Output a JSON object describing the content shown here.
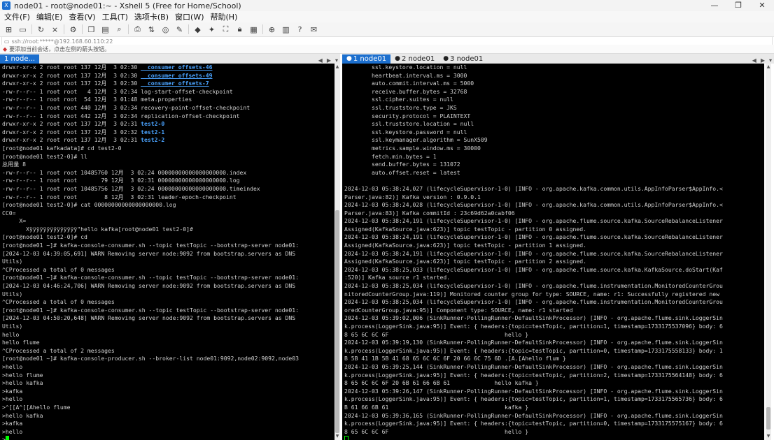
{
  "window": {
    "title": "node01 - root@node01:~ - Xshell 5 (Free for Home/School)",
    "controls": {
      "minimize": "—",
      "maximize": "❐",
      "close": "✕"
    }
  },
  "menu": [
    "文件(F)",
    "编辑(E)",
    "查看(V)",
    "工具(T)",
    "选项卡(B)",
    "窗口(W)",
    "帮助(H)"
  ],
  "toolbar": {
    "icons": [
      "new-session-icon",
      "open-folder-icon",
      "reconnect-icon",
      "disconnect-icon",
      "properties-icon",
      "copy-icon",
      "paste-icon",
      "find-icon",
      "print-icon",
      "transfer-icon",
      "globe-icon",
      "highlight-icon",
      "xftp-icon",
      "compose-icon",
      "fullscreen-icon",
      "lock-icon",
      "keyboard-icon",
      "add-icon",
      "layout-icon",
      "help-icon",
      "chat-icon"
    ]
  },
  "address": {
    "text": "ssh://root:*****@192.168.60.110:22"
  },
  "hint": {
    "text": "要添加当前会话，点击左侧的箭头按钮。"
  },
  "left_tabs": [
    {
      "label": "1 node...",
      "active": true
    }
  ],
  "right_tabs": [
    {
      "label": "1 node01",
      "active": true
    },
    {
      "label": "2 node01",
      "active": false
    },
    {
      "label": "3 node01",
      "active": false
    }
  ],
  "left_terminal": {
    "lines": [
      {
        "t": "drwxr-xr-x 2 root root 137 12月  3 02:30 ",
        "h": "__consumer_offsets-46",
        "style": "blue-u"
      },
      {
        "t": "drwxr-xr-x 2 root root 137 12月  3 02:30 ",
        "h": "__consumer_offsets-49",
        "style": "blue-u"
      },
      {
        "t": "drwxr-xr-x 2 root root 137 12月  3 02:30 ",
        "h": "__consumer_offsets-7",
        "style": "blue-u"
      },
      {
        "t": "-rw-r--r-- 1 root root   4 12月  3 02:34 log-start-offset-checkpoint"
      },
      {
        "t": "-rw-r--r-- 1 root root  54 12月  3 01:48 meta.properties"
      },
      {
        "t": "-rw-r--r-- 1 root root 440 12月  3 02:34 recovery-point-offset-checkpoint"
      },
      {
        "t": "-rw-r--r-- 1 root root 442 12月  3 02:34 replication-offset-checkpoint"
      },
      {
        "t": "drwxr-xr-x 2 root root 137 12月  3 02:31 ",
        "h": "test2-0",
        "style": "blue"
      },
      {
        "t": "drwxr-xr-x 2 root root 137 12月  3 02:32 ",
        "h": "test2-1",
        "style": "blue"
      },
      {
        "t": "drwxr-xr-x 2 root root 137 12月  3 02:31 ",
        "h": "test2-2",
        "style": "blue"
      },
      {
        "t": "[root@node01 kafkadata]# cd test2-0"
      },
      {
        "t": "[root@node01 test2-0]# ll"
      },
      {
        "t": "总用量 8"
      },
      {
        "t": "-rw-r--r-- 1 root root 10485760 12月  3 02:24 00000000000000000000.index"
      },
      {
        "t": "-rw-r--r-- 1 root root       79 12月  3 02:31 00000000000000000000.log"
      },
      {
        "t": "-rw-r--r-- 1 root root 10485756 12月  3 02:24 00000000000000000000.timeindex"
      },
      {
        "t": "-rw-r--r-- 1 root root        8 12月  3 02:31 leader-epoch-checkpoint"
      },
      {
        "t": "[root@node01 test2-0]# cat 00000000000000000000.log"
      },
      {
        "t": "CC0="
      },
      {
        "t": "     X="
      },
      {
        "t": "       Xÿÿÿÿÿÿÿÿÿÿÿÿÿÿ\"hello kafka[root@node01 test2-0]#"
      },
      {
        "t": "[root@node01 test2-0]# cd"
      },
      {
        "t": "[root@node01 ~]# kafka-console-consumer.sh --topic testTopic --bootstrap-server node01:"
      },
      {
        "t": "[2024-12-03 04:39:05,691] WARN Removing server node:9092 from bootstrap.servers as DNS"
      },
      {
        "t": "Utils)"
      },
      {
        "t": "^CProcessed a total of 0 messages"
      },
      {
        "t": "[root@node01 ~]# kafka-console-consumer.sh --topic testTopic --bootstrap-server node01:"
      },
      {
        "t": "[2024-12-03 04:46:24,706] WARN Removing server node:9092 from bootstrap.servers as DNS"
      },
      {
        "t": "Utils)"
      },
      {
        "t": "^CProcessed a total of 0 messages"
      },
      {
        "t": "[root@node01 ~]# kafka-console-consumer.sh --topic testTopic --bootstrap-server node01:"
      },
      {
        "t": "[2024-12-03 04:50:20,648] WARN Removing server node:9092 from bootstrap.servers as DNS"
      },
      {
        "t": "Utils)"
      },
      {
        "t": "hello"
      },
      {
        "t": "hello flume"
      },
      {
        "t": "^CProcessed a total of 2 messages"
      },
      {
        "t": "[root@node01 ~]# kafka-console-producer.sh --broker-list node01:9092,node02:9092,node03"
      },
      {
        "t": ">hello"
      },
      {
        "t": ">hello flume"
      },
      {
        "t": ">hello kafka"
      },
      {
        "t": ">kafka"
      },
      {
        "t": ">hello"
      },
      {
        "t": ">^[[A^[[Ahello flume"
      },
      {
        "t": ">hello kafka"
      },
      {
        "t": ">kafka"
      },
      {
        "t": ">hello"
      },
      {
        "t": ">",
        "cursor": "solid"
      }
    ]
  },
  "right_terminal": {
    "lines": [
      {
        "t": "        ssl.keystore.location = null"
      },
      {
        "t": "        heartbeat.interval.ms = 3000"
      },
      {
        "t": "        auto.commit.interval.ms = 5000"
      },
      {
        "t": "        receive.buffer.bytes = 32768"
      },
      {
        "t": "        ssl.cipher.suites = null"
      },
      {
        "t": "        ssl.truststore.type = JKS"
      },
      {
        "t": "        security.protocol = PLAINTEXT"
      },
      {
        "t": "        ssl.truststore.location = null"
      },
      {
        "t": "        ssl.keystore.password = null"
      },
      {
        "t": "        ssl.keymanager.algorithm = SunX509"
      },
      {
        "t": "        metrics.sample.window.ms = 30000"
      },
      {
        "t": "        fetch.min.bytes = 1"
      },
      {
        "t": "        send.buffer.bytes = 131072"
      },
      {
        "t": "        auto.offset.reset = latest"
      },
      {
        "t": ""
      },
      {
        "t": "2024-12-03 05:38:24,027 (lifecycleSupervisor-1-0) [INFO - org.apache.kafka.common.utils.AppInfoParser$AppInfo.<"
      },
      {
        "t": "Parser.java:82)] Kafka version : 0.9.0.1"
      },
      {
        "t": "2024-12-03 05:38:24,028 (lifecycleSupervisor-1-0) [INFO - org.apache.kafka.common.utils.AppInfoParser$AppInfo.<"
      },
      {
        "t": "Parser.java:83)] Kafka commitId : 23c69d62a0cabf06"
      },
      {
        "t": "2024-12-03 05:38:24,191 (lifecycleSupervisor-1-0) [INFO - org.apache.flume.source.kafka.SourceRebalanceListener"
      },
      {
        "t": "Assigned(KafkaSource.java:623)] topic testTopic - partition 0 assigned."
      },
      {
        "t": "2024-12-03 05:38:24,191 (lifecycleSupervisor-1-0) [INFO - org.apache.flume.source.kafka.SourceRebalanceListener"
      },
      {
        "t": "Assigned(KafkaSource.java:623)] topic testTopic - partition 1 assigned."
      },
      {
        "t": "2024-12-03 05:38:24,191 (lifecycleSupervisor-1-0) [INFO - org.apache.flume.source.kafka.SourceRebalanceListener"
      },
      {
        "t": "Assigned(KafkaSource.java:623)] topic testTopic - partition 2 assigned."
      },
      {
        "t": "2024-12-03 05:38:25,033 (lifecycleSupervisor-1-0) [INFO - org.apache.flume.source.kafka.KafkaSource.doStart(Kaf"
      },
      {
        "t": ":520)] Kafka source r1 started."
      },
      {
        "t": "2024-12-03 05:38:25,034 (lifecycleSupervisor-1-0) [INFO - org.apache.flume.instrumentation.MonitoredCounterGrou"
      },
      {
        "t": "nitoredCounterGroup.java:119)] Monitored counter group for type: SOURCE, name: r1: Successfully registered new"
      },
      {
        "t": "2024-12-03 05:38:25,034 (lifecycleSupervisor-1-0) [INFO - org.apache.flume.instrumentation.MonitoredCounterGrou"
      },
      {
        "t": "oredCounterGroup.java:95)] Component type: SOURCE, name: r1 started"
      },
      {
        "t": "2024-12-03 05:39:02,006 (SinkRunner-PollingRunner-DefaultSinkProcessor) [INFO - org.apache.flume.sink.LoggerSin"
      },
      {
        "t": "k.process(LoggerSink.java:95)] Event: { headers:{topic=testTopic, partition=1, timestamp=1733175537096} body: 6"
      },
      {
        "t": "8 65 6C 6C 6F                                  hello }"
      },
      {
        "t": "2024-12-03 05:39:19,130 (SinkRunner-PollingRunner-DefaultSinkProcessor) [INFO - org.apache.flume.sink.LoggerSin"
      },
      {
        "t": "k.process(LoggerSink.java:95)] Event: { headers:{topic=testTopic, partition=0, timestamp=1733175558133} body: 1"
      },
      {
        "t": "B 5B 41 1B 5B 41 68 65 6C 6C 6F 20 66 6C 75 6D .[A.[Ahello flum }"
      },
      {
        "t": "2024-12-03 05:39:25,144 (SinkRunner-PollingRunner-DefaultSinkProcessor) [INFO - org.apache.flume.sink.LoggerSin"
      },
      {
        "t": "k.process(LoggerSink.java:95)] Event: { headers:{topic=testTopic, partition=2, timestamp=1733175564148} body: 6"
      },
      {
        "t": "8 65 6C 6C 6F 20 6B 61 66 6B 61             hello kafka }"
      },
      {
        "t": "2024-12-03 05:39:26,147 (SinkRunner-PollingRunner-DefaultSinkProcessor) [INFO - org.apache.flume.sink.LoggerSin"
      },
      {
        "t": "k.process(LoggerSink.java:95)] Event: { headers:{topic=testTopic, partition=1, timestamp=1733175565736} body: 6"
      },
      {
        "t": "B 61 66 6B 61                                  kafka }"
      },
      {
        "t": "2024-12-03 05:39:36,165 (SinkRunner-PollingRunner-DefaultSinkProcessor) [INFO - org.apache.flume.sink.LoggerSin"
      },
      {
        "t": "k.process(LoggerSink.java:95)] Event: { headers:{topic=testTopic, partition=0, timestamp=1733175575167} body: 6"
      },
      {
        "t": "8 65 6C 6C 6F                                  hello }"
      },
      {
        "t": "",
        "cursor": "hollow"
      }
    ]
  },
  "colors": {
    "tab_active": "#1c6fce",
    "terminal_bg": "#000000",
    "terminal_fg": "#d0d0d0",
    "dir_blue": "#4aa3ff",
    "cursor": "#00ff00"
  }
}
